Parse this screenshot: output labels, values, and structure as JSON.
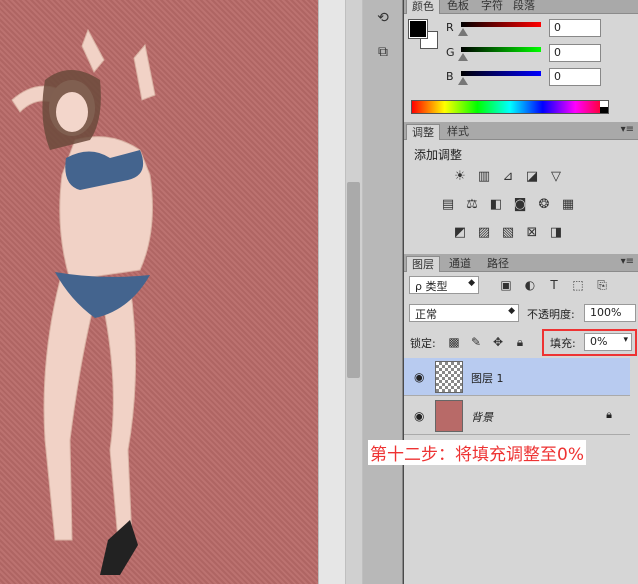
{
  "toolstrip": {
    "icons": [
      "history-icon",
      "3d-icon"
    ]
  },
  "color_panel": {
    "tabs": [
      "颜色",
      "色板",
      "字符",
      "段落"
    ],
    "channels": [
      {
        "label": "R",
        "value": "0",
        "color": "#e02020"
      },
      {
        "label": "G",
        "value": "0",
        "color": "#20c020"
      },
      {
        "label": "B",
        "value": "0",
        "color": "#2030e0"
      }
    ]
  },
  "adjustments_panel": {
    "tabs": [
      "调整",
      "样式"
    ],
    "title": "添加调整",
    "icon_rows": [
      [
        "brightness-icon",
        "levels-icon",
        "curves-icon",
        "exposure-icon",
        "vibrance-icon"
      ],
      [
        "hue-icon",
        "color-balance-icon",
        "bw-icon",
        "photo-filter-icon",
        "channel-mixer-icon",
        "color-lookup-icon"
      ],
      [
        "invert-icon",
        "posterize-icon",
        "threshold-icon",
        "selective-color-icon",
        "gradient-map-icon"
      ]
    ]
  },
  "layers_panel": {
    "tabs": [
      "图层",
      "通道",
      "路径"
    ],
    "filter_label": "ρ 类型",
    "blend_mode": "正常",
    "opacity_label": "不透明度:",
    "opacity_value": "100%",
    "lock_label": "锁定:",
    "fill_label": "填充:",
    "fill_value": "0%",
    "layers": [
      {
        "name": "图层 1",
        "selected": true
      },
      {
        "name": "背景",
        "selected": false,
        "locked": true
      }
    ]
  },
  "caption": "第十二步：将填充调整至0%"
}
